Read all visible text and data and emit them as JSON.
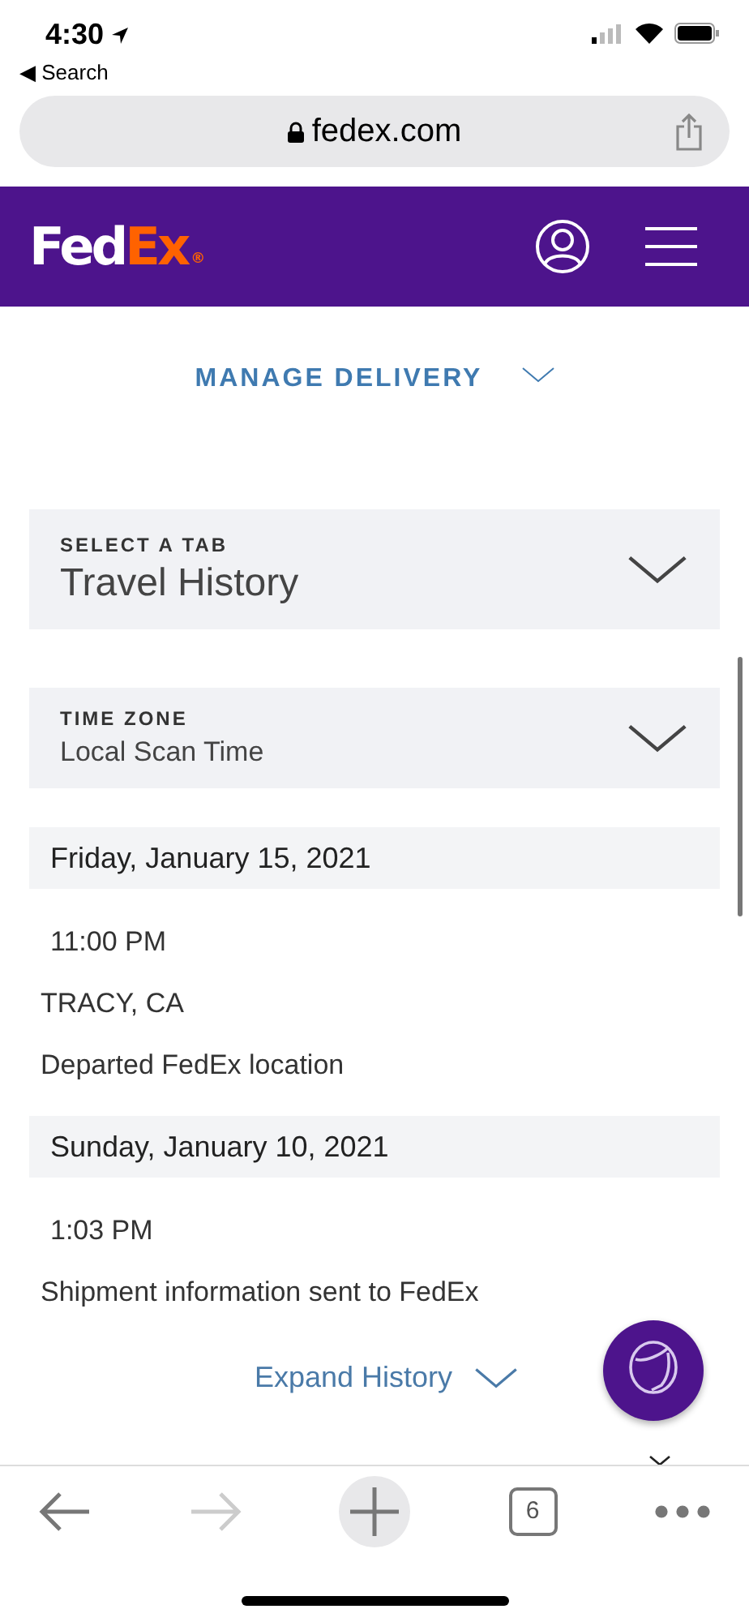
{
  "status_bar": {
    "time": "4:30",
    "back_label": "◀ Search"
  },
  "browser": {
    "url": "fedex.com"
  },
  "header": {
    "logo_first": "Fed",
    "logo_second": "Ex",
    "logo_mark": "®"
  },
  "manage_delivery": {
    "label": "MANAGE DELIVERY",
    "expanded": false
  },
  "selects": [
    {
      "label": "SELECT A TAB",
      "value": "Travel History",
      "kind": "large"
    },
    {
      "label": "TIME ZONE",
      "value": "Local Scan Time",
      "kind": "small"
    }
  ],
  "history": [
    {
      "kind": "date",
      "text": "Friday, January 15, 2021"
    },
    {
      "kind": "time",
      "text": "11:00 PM"
    },
    {
      "kind": "location",
      "text": "TRACY, CA"
    },
    {
      "kind": "status",
      "text": "Departed FedEx location"
    },
    {
      "kind": "date",
      "text": "Sunday, January 10, 2021"
    },
    {
      "kind": "time",
      "text": "1:03 PM"
    },
    {
      "kind": "status",
      "text": "Shipment information sent to FedEx"
    }
  ],
  "expand_history": {
    "label": "Expand History"
  },
  "toolbar": {
    "back_disabled": false,
    "forward_disabled": true,
    "tab_count": "6"
  }
}
